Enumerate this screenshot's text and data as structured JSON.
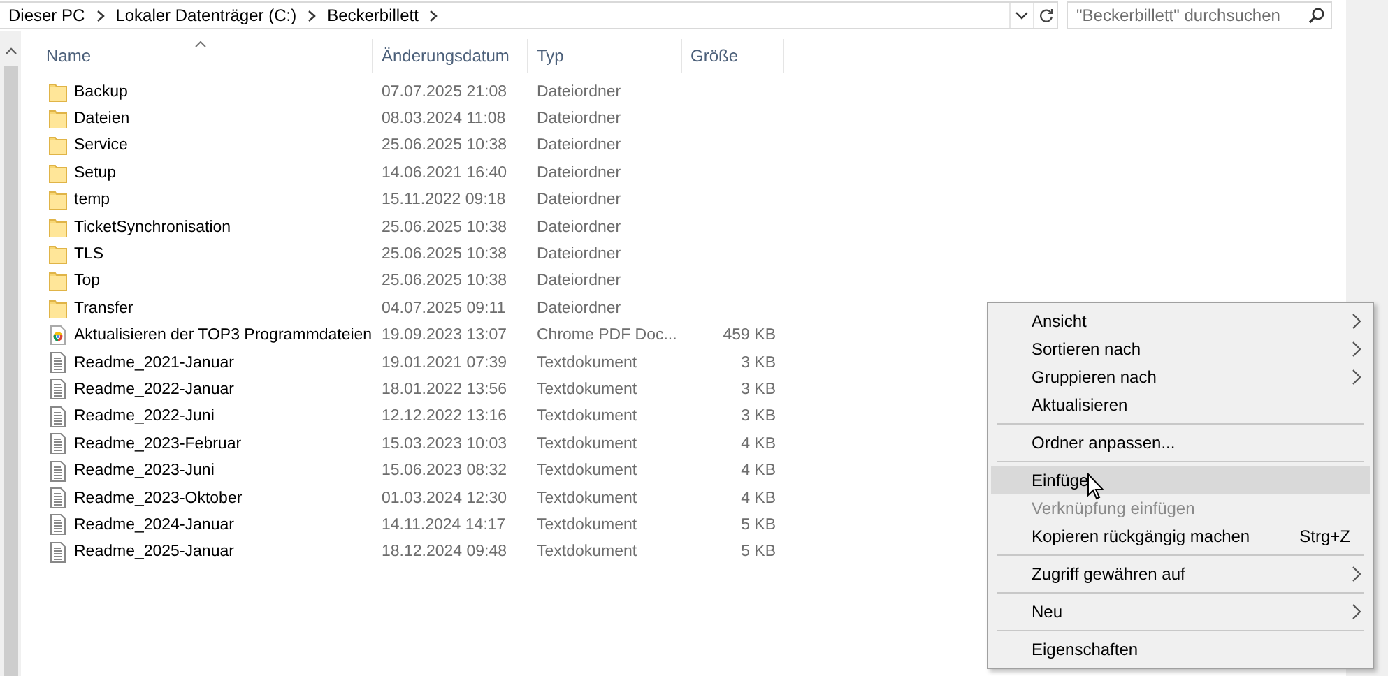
{
  "address_bar": {
    "crumbs": [
      "Dieser PC",
      "Lokaler Datenträger (C:)",
      "Beckerbillett"
    ]
  },
  "search": {
    "placeholder": "\"Beckerbillett\" durchsuchen"
  },
  "columns": [
    {
      "label": "Name",
      "sorted": true
    },
    {
      "label": "Änderungsdatum",
      "sorted": false
    },
    {
      "label": "Typ",
      "sorted": false
    },
    {
      "label": "Größe",
      "sorted": false
    }
  ],
  "files": [
    {
      "kind": "folder",
      "name": "Backup",
      "date": "07.07.2025 21:08",
      "type": "Dateiordner"
    },
    {
      "kind": "folder",
      "name": "Dateien",
      "date": "08.03.2024 11:08",
      "type": "Dateiordner"
    },
    {
      "kind": "folder",
      "name": "Service",
      "date": "25.06.2025 10:38",
      "type": "Dateiordner"
    },
    {
      "kind": "folder",
      "name": "Setup",
      "date": "14.06.2021 16:40",
      "type": "Dateiordner"
    },
    {
      "kind": "folder",
      "name": "temp",
      "date": "15.11.2022 09:18",
      "type": "Dateiordner"
    },
    {
      "kind": "folder",
      "name": "TicketSynchronisation",
      "date": "25.06.2025 10:38",
      "type": "Dateiordner"
    },
    {
      "kind": "folder",
      "name": "TLS",
      "date": "25.06.2025 10:38",
      "type": "Dateiordner"
    },
    {
      "kind": "folder",
      "name": "Top",
      "date": "25.06.2025 10:38",
      "type": "Dateiordner"
    },
    {
      "kind": "folder",
      "name": "Transfer",
      "date": "04.07.2025 09:11",
      "type": "Dateiordner"
    },
    {
      "kind": "pdf",
      "name": "Aktualisieren der TOP3 Programmdateien",
      "date": "19.09.2023 13:07",
      "type": "Chrome PDF Doc...",
      "size": "459 KB"
    },
    {
      "kind": "text",
      "name": "Readme_2021-Januar",
      "date": "19.01.2021 07:39",
      "type": "Textdokument",
      "size": "3 KB"
    },
    {
      "kind": "text",
      "name": "Readme_2022-Januar",
      "date": "18.01.2022 13:56",
      "type": "Textdokument",
      "size": "3 KB"
    },
    {
      "kind": "text",
      "name": "Readme_2022-Juni",
      "date": "12.12.2022 13:16",
      "type": "Textdokument",
      "size": "3 KB"
    },
    {
      "kind": "text",
      "name": "Readme_2023-Februar",
      "date": "15.03.2023 10:03",
      "type": "Textdokument",
      "size": "4 KB"
    },
    {
      "kind": "text",
      "name": "Readme_2023-Juni",
      "date": "15.06.2023 08:32",
      "type": "Textdokument",
      "size": "4 KB"
    },
    {
      "kind": "text",
      "name": "Readme_2023-Oktober",
      "date": "01.03.2024 12:30",
      "type": "Textdokument",
      "size": "4 KB"
    },
    {
      "kind": "text",
      "name": "Readme_2024-Januar",
      "date": "14.11.2024 14:17",
      "type": "Textdokument",
      "size": "5 KB"
    },
    {
      "kind": "text",
      "name": "Readme_2025-Januar",
      "date": "18.12.2024 09:48",
      "type": "Textdokument",
      "size": "5 KB"
    }
  ],
  "context_menu": [
    {
      "kind": "item",
      "label": "Ansicht",
      "submenu": true,
      "disabled": false,
      "selected": false
    },
    {
      "kind": "item",
      "label": "Sortieren nach",
      "submenu": true,
      "disabled": false,
      "selected": false
    },
    {
      "kind": "item",
      "label": "Gruppieren nach",
      "submenu": true,
      "disabled": false,
      "selected": false
    },
    {
      "kind": "item",
      "label": "Aktualisieren",
      "submenu": false,
      "disabled": false,
      "selected": false
    },
    {
      "kind": "separator"
    },
    {
      "kind": "item",
      "label": "Ordner anpassen...",
      "submenu": false,
      "disabled": false,
      "selected": false
    },
    {
      "kind": "separator"
    },
    {
      "kind": "item",
      "label": "Einfüge",
      "submenu": false,
      "disabled": false,
      "selected": true
    },
    {
      "kind": "item",
      "label": "Verknüpfung einfügen",
      "submenu": false,
      "disabled": true,
      "selected": false
    },
    {
      "kind": "item",
      "label": "Kopieren rückgängig machen",
      "shortcut": "Strg+Z",
      "submenu": false,
      "disabled": false,
      "selected": false
    },
    {
      "kind": "separator"
    },
    {
      "kind": "item",
      "label": "Zugriff gewähren auf",
      "submenu": true,
      "disabled": false,
      "selected": false
    },
    {
      "kind": "separator"
    },
    {
      "kind": "item",
      "label": "Neu",
      "submenu": true,
      "disabled": false,
      "selected": false
    },
    {
      "kind": "separator"
    },
    {
      "kind": "item",
      "label": "Eigenschaften",
      "submenu": false,
      "disabled": false,
      "selected": false
    }
  ]
}
